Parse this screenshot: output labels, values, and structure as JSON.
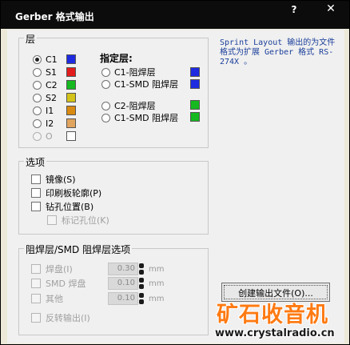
{
  "window": {
    "title": "Gerber 格式输出",
    "help_label": "?",
    "close_label": "✕"
  },
  "layers": {
    "group_label": "层",
    "items": [
      {
        "label": "C1",
        "color": "#1f2be0",
        "selected": true,
        "enabled": true
      },
      {
        "label": "S1",
        "color": "#e01c1c",
        "selected": false,
        "enabled": true
      },
      {
        "label": "C2",
        "color": "#16b91f",
        "selected": false,
        "enabled": true
      },
      {
        "label": "S2",
        "color": "#d4c31a",
        "selected": false,
        "enabled": true
      },
      {
        "label": "I1",
        "color": "#d88a12",
        "selected": false,
        "enabled": true
      },
      {
        "label": "I2",
        "color": "#e0a45e",
        "selected": false,
        "enabled": true
      },
      {
        "label": "O",
        "color": "#ffffff",
        "selected": false,
        "enabled": false
      }
    ],
    "designated_title": "指定层:",
    "designated": [
      {
        "label": "C1-阻焊层",
        "color": "#1f2be0"
      },
      {
        "label": "C1-SMD 阻焊层",
        "color": "#1f2be0"
      },
      {
        "label": "C2-阻焊层",
        "color": "#16b91f"
      },
      {
        "label": "C1-SMD 阻焊层",
        "color": "#16b91f"
      }
    ]
  },
  "options": {
    "group_label": "选项",
    "mirror": "镜像(S)",
    "board_outline": "印刷板轮廓(P)",
    "drill_position": "钻孔位置(B)",
    "mark_drill": "标记孔位(K)"
  },
  "solder_mask": {
    "group_label": "阻焊层/SMD 阻焊层选项",
    "rows": [
      {
        "label": "焊盘(I)",
        "value": "0.30",
        "unit": "mm"
      },
      {
        "label": "SMD 焊盘",
        "value": "0.10",
        "unit": "mm"
      },
      {
        "label": "其他",
        "value": "0.10",
        "unit": "mm"
      }
    ],
    "invert_output": "反转输出(I)"
  },
  "info_text": "Sprint Layout 输出的为文件格式为扩展 Gerber 格式 RS-274X 。",
  "buttons": {
    "create_output": "创建输出文件(O)..."
  },
  "watermark": {
    "logo": "矿石收音机",
    "url": "www.crystalradio.cn"
  }
}
